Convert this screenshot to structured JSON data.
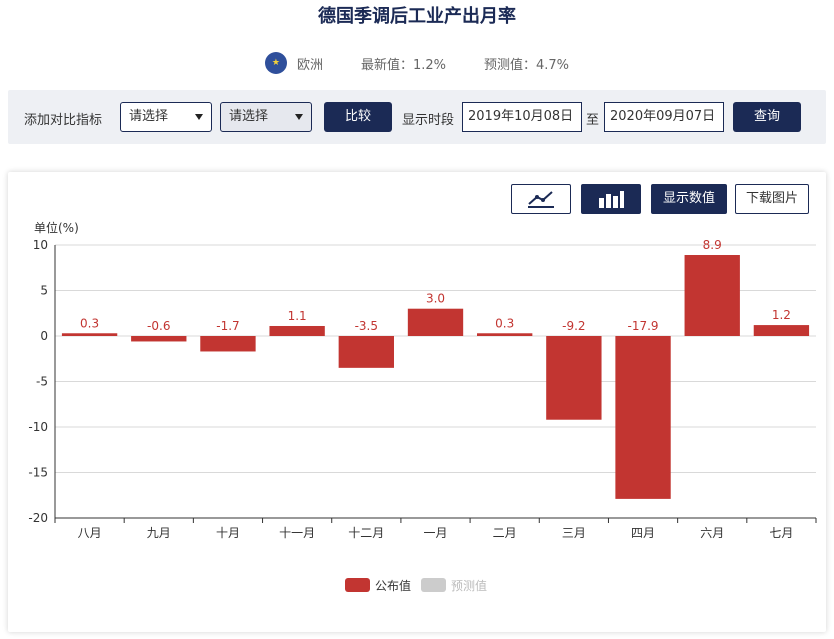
{
  "header": {
    "title": "德国季调后工业产出月率",
    "region": "欧洲",
    "latest": "最新值：1.2%",
    "forecast": "预测值：4.7%"
  },
  "toolbar": {
    "add_label": "添加对比指标",
    "select1": "请选择",
    "select2": "请选择",
    "compare_button": "比较",
    "period_label": "显示时段",
    "start_date": "2019年10月08日",
    "to_label": "至",
    "end_date": "2020年09月07日",
    "query_button": "查询"
  },
  "controls": {
    "line_icon": "line-chart-icon",
    "bar_icon": "bar-chart-icon",
    "show_values": "显示数值",
    "download": "下载图片"
  },
  "colors": {
    "accent": "#1b2a55",
    "bar": "#c23531",
    "forecast_legend": "#cccccc"
  },
  "chart_data": {
    "type": "bar",
    "ylabel": "单位(%)",
    "categories": [
      "八月",
      "九月",
      "十月",
      "十一月",
      "十二月",
      "一月",
      "二月",
      "三月",
      "四月",
      "六月",
      "七月"
    ],
    "series": [
      {
        "name": "公布值",
        "values": [
          0.3,
          -0.6,
          -1.7,
          1.1,
          -3.5,
          3.0,
          0.3,
          -9.2,
          -17.9,
          8.9,
          1.2
        ]
      },
      {
        "name": "预测值",
        "values": []
      }
    ],
    "value_labels": [
      "0.3",
      "-0.6",
      "-1.7",
      "1.1",
      "-3.5",
      "3.0",
      "0.3",
      "-9.2",
      "-17.9",
      "8.9",
      "1.2"
    ],
    "yticks": [
      "10",
      "5",
      "0",
      "-5",
      "-10",
      "-15",
      "-20"
    ],
    "ylim": [
      -20,
      10
    ],
    "grid": true,
    "legend": "bottom-center"
  }
}
